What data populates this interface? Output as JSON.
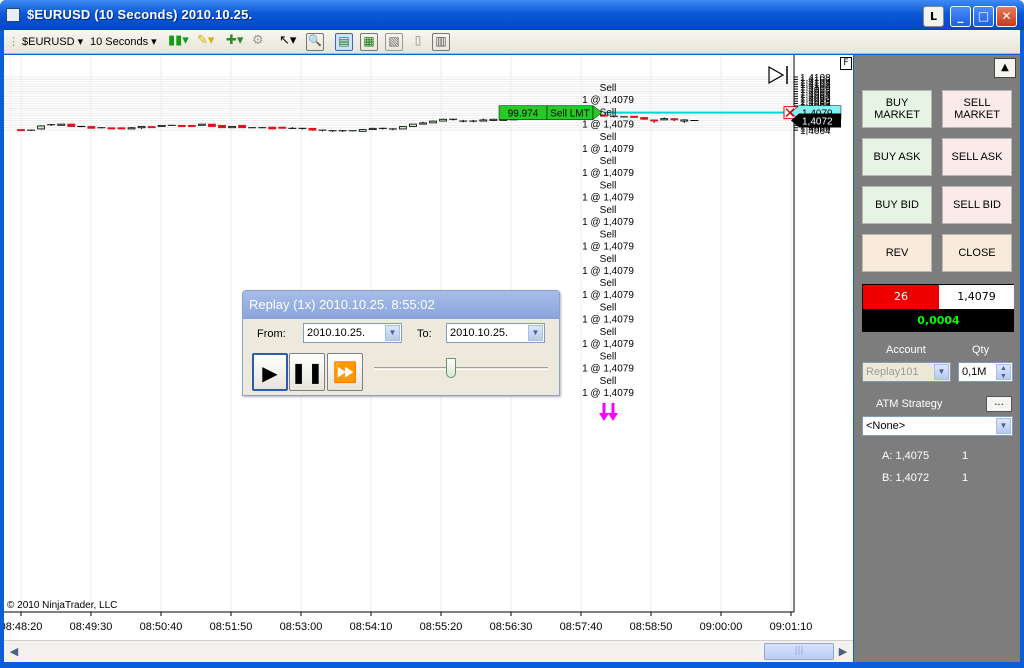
{
  "window": {
    "title": "$EURUSD (10 Seconds)  2010.10.25.",
    "buttons": {
      "lock": "L",
      "minimize": "_",
      "maximize": "□",
      "close": "✕"
    }
  },
  "toolbar": {
    "instrument": "$EURUSD",
    "interval": "10 Seconds",
    "icons": [
      "bar-style-icon",
      "pencil-draw-icon",
      "add-indicator-icon",
      "strategy-icon",
      "pointer-icon",
      "zoom-icon",
      "chart-trader-icon",
      "data-box-icon",
      "properties-icon",
      "page-icon",
      "columns-icon"
    ]
  },
  "chart": {
    "copyright": "© 2010 NinjaTrader, LLC",
    "f_marker": "F",
    "price_labels": [
      "1,4108",
      "1,4106",
      "1,4104",
      "1,4102",
      "1,4100",
      "1,4098",
      "1,4096",
      "1,4094",
      "1,4092",
      "1,4090",
      "1,4088",
      "1,4086",
      "1,4084",
      "1,4082",
      "1,4080",
      "1,4079",
      "1,4076",
      "1,4074",
      "1,4072",
      "1,4070",
      "1,4068",
      "1,4066",
      "1,4064"
    ],
    "time_labels": [
      "08:48:20",
      "08:49:30",
      "08:50:40",
      "08:51:50",
      "08:53:00",
      "08:54:10",
      "08:55:20",
      "08:56:30",
      "08:57:40",
      "08:58:50",
      "09:00:00",
      "09:01:10"
    ],
    "current_price_label": "1,4072",
    "order_line": {
      "qty": "99.974",
      "type": "Sell LMT",
      "price": "1,4079"
    },
    "execution_labels_top": "Sell",
    "execution_labels_bottom": "1 @ 1,4079",
    "execution_count": 13,
    "candles": [
      {
        "o": 1.40645,
        "h": 1.40645,
        "l": 1.40635,
        "c": 1.40635
      },
      {
        "o": 1.4064,
        "h": 1.40645,
        "l": 1.40635,
        "c": 1.4064
      },
      {
        "o": 1.4065,
        "h": 1.4068,
        "l": 1.40645,
        "c": 1.40675
      },
      {
        "o": 1.4068,
        "h": 1.4069,
        "l": 1.40675,
        "c": 1.40685
      },
      {
        "o": 1.4068,
        "h": 1.4069,
        "l": 1.4068,
        "c": 1.4069
      },
      {
        "o": 1.4069,
        "h": 1.4069,
        "l": 1.4067,
        "c": 1.4067
      },
      {
        "o": 1.4067,
        "h": 1.40675,
        "l": 1.40665,
        "c": 1.4067
      },
      {
        "o": 1.4067,
        "h": 1.40675,
        "l": 1.40655,
        "c": 1.40655
      },
      {
        "o": 1.40655,
        "h": 1.40665,
        "l": 1.40655,
        "c": 1.4066
      },
      {
        "o": 1.4066,
        "h": 1.4066,
        "l": 1.4065,
        "c": 1.4065
      },
      {
        "o": 1.4066,
        "h": 1.4066,
        "l": 1.4065,
        "c": 1.4065
      },
      {
        "o": 1.4065,
        "h": 1.40665,
        "l": 1.4065,
        "c": 1.4066
      },
      {
        "o": 1.4066,
        "h": 1.4067,
        "l": 1.4065,
        "c": 1.4067
      },
      {
        "o": 1.4067,
        "h": 1.4067,
        "l": 1.4066,
        "c": 1.4066
      },
      {
        "o": 1.4067,
        "h": 1.4068,
        "l": 1.4067,
        "c": 1.4068
      },
      {
        "o": 1.4068,
        "h": 1.4068,
        "l": 1.4068,
        "c": 1.4068
      },
      {
        "o": 1.4068,
        "h": 1.4068,
        "l": 1.4067,
        "c": 1.4067
      },
      {
        "o": 1.4068,
        "h": 1.4068,
        "l": 1.4067,
        "c": 1.4067
      },
      {
        "o": 1.4068,
        "h": 1.4069,
        "l": 1.4068,
        "c": 1.4069
      },
      {
        "o": 1.4069,
        "h": 1.4069,
        "l": 1.4067,
        "c": 1.4067
      },
      {
        "o": 1.4068,
        "h": 1.4068,
        "l": 1.4066,
        "c": 1.4066
      },
      {
        "o": 1.4066,
        "h": 1.4067,
        "l": 1.4066,
        "c": 1.4067
      },
      {
        "o": 1.4068,
        "h": 1.4068,
        "l": 1.4066,
        "c": 1.4066
      },
      {
        "o": 1.4066,
        "h": 1.40665,
        "l": 1.4066,
        "c": 1.4066
      },
      {
        "o": 1.4066,
        "h": 1.40665,
        "l": 1.4066,
        "c": 1.4066
      },
      {
        "o": 1.40665,
        "h": 1.40665,
        "l": 1.4065,
        "c": 1.4065
      },
      {
        "o": 1.40665,
        "h": 1.40665,
        "l": 1.40655,
        "c": 1.40655
      },
      {
        "o": 1.40655,
        "h": 1.40665,
        "l": 1.4065,
        "c": 1.40655
      },
      {
        "o": 1.40655,
        "h": 1.40655,
        "l": 1.40645,
        "c": 1.4065
      },
      {
        "o": 1.40655,
        "h": 1.40655,
        "l": 1.40635,
        "c": 1.4064
      },
      {
        "o": 1.4064,
        "h": 1.4064,
        "l": 1.4063,
        "c": 1.40635
      },
      {
        "o": 1.40635,
        "h": 1.40635,
        "l": 1.40625,
        "c": 1.4063
      },
      {
        "o": 1.4063,
        "h": 1.4064,
        "l": 1.40625,
        "c": 1.40635
      },
      {
        "o": 1.40635,
        "h": 1.40635,
        "l": 1.4063,
        "c": 1.4063
      },
      {
        "o": 1.4063,
        "h": 1.4065,
        "l": 1.4063,
        "c": 1.40645
      },
      {
        "o": 1.40645,
        "h": 1.4066,
        "l": 1.40645,
        "c": 1.40655
      },
      {
        "o": 1.40655,
        "h": 1.4066,
        "l": 1.40645,
        "c": 1.40655
      },
      {
        "o": 1.40645,
        "h": 1.40655,
        "l": 1.4064,
        "c": 1.4065
      },
      {
        "o": 1.4065,
        "h": 1.4067,
        "l": 1.4065,
        "c": 1.4067
      },
      {
        "o": 1.4067,
        "h": 1.4069,
        "l": 1.4067,
        "c": 1.4069
      },
      {
        "o": 1.4069,
        "h": 1.4071,
        "l": 1.4069,
        "c": 1.407
      },
      {
        "o": 1.407,
        "h": 1.4072,
        "l": 1.407,
        "c": 1.40715
      },
      {
        "o": 1.40715,
        "h": 1.40735,
        "l": 1.40715,
        "c": 1.4073
      },
      {
        "o": 1.4073,
        "h": 1.40735,
        "l": 1.4072,
        "c": 1.4073
      },
      {
        "o": 1.40715,
        "h": 1.40725,
        "l": 1.40705,
        "c": 1.40715
      },
      {
        "o": 1.40715,
        "h": 1.40725,
        "l": 1.40705,
        "c": 1.40715
      },
      {
        "o": 1.40715,
        "h": 1.40735,
        "l": 1.40715,
        "c": 1.40725
      },
      {
        "o": 1.4072,
        "h": 1.40735,
        "l": 1.40715,
        "c": 1.4073
      },
      {
        "o": 1.4072,
        "h": 1.40735,
        "l": 1.4072,
        "c": 1.4073
      },
      {
        "o": 1.40725,
        "h": 1.40745,
        "l": 1.40725,
        "c": 1.4074
      },
      {
        "o": 1.4074,
        "h": 1.4077,
        "l": 1.4074,
        "c": 1.4076
      },
      {
        "o": 1.4076,
        "h": 1.40765,
        "l": 1.40755,
        "c": 1.4076
      },
      {
        "o": 1.4076,
        "h": 1.40765,
        "l": 1.40755,
        "c": 1.4076
      },
      {
        "o": 1.40755,
        "h": 1.4077,
        "l": 1.4075,
        "c": 1.40765
      },
      {
        "o": 1.40765,
        "h": 1.40775,
        "l": 1.40765,
        "c": 1.4077
      },
      {
        "o": 1.4077,
        "h": 1.40785,
        "l": 1.4077,
        "c": 1.4078
      },
      {
        "o": 1.4078,
        "h": 1.4079,
        "l": 1.40775,
        "c": 1.40785
      },
      {
        "o": 1.40785,
        "h": 1.4079,
        "l": 1.4076,
        "c": 1.40765
      },
      {
        "o": 1.40765,
        "h": 1.40765,
        "l": 1.40755,
        "c": 1.40755
      },
      {
        "o": 1.40755,
        "h": 1.4076,
        "l": 1.40745,
        "c": 1.4075
      },
      {
        "o": 1.4075,
        "h": 1.40755,
        "l": 1.40745,
        "c": 1.4075
      },
      {
        "o": 1.40755,
        "h": 1.40755,
        "l": 1.4074,
        "c": 1.40745
      },
      {
        "o": 1.40745,
        "h": 1.40745,
        "l": 1.40725,
        "c": 1.4073
      },
      {
        "o": 1.40725,
        "h": 1.40725,
        "l": 1.407,
        "c": 1.40715
      },
      {
        "o": 1.40725,
        "h": 1.40745,
        "l": 1.40725,
        "c": 1.40735
      },
      {
        "o": 1.40735,
        "h": 1.4074,
        "l": 1.40715,
        "c": 1.40725
      },
      {
        "o": 1.40715,
        "h": 1.4073,
        "l": 1.407,
        "c": 1.40725
      },
      {
        "o": 1.4072,
        "h": 1.4072,
        "l": 1.4072,
        "c": 1.4072
      }
    ]
  },
  "replay": {
    "title": "Replay (1x) 2010.10.25.  8:55:02",
    "from_label": "From:",
    "from_value": "2010.10.25.",
    "to_label": "To:",
    "to_value": "2010.10.25.",
    "speed_position": 0.45
  },
  "trade_panel": {
    "buttons": {
      "buy_market": "BUY\nMARKET",
      "sell_market": "SELL\nMARKET",
      "buy_ask": "BUY ASK",
      "sell_ask": "SELL ASK",
      "buy_bid": "BUY BID",
      "sell_bid": "SELL BID",
      "rev": "REV",
      "close": "CLOSE"
    },
    "position": {
      "qty": "26",
      "price": "1,4079",
      "pnl": "0,0004"
    },
    "account_label": "Account",
    "account_value": "Replay101",
    "qty_label": "Qty",
    "qty_value": "0,1M",
    "atm_label": "ATM Strategy",
    "atm_button": "...",
    "atm_value": "<None>",
    "ask_label": "A: 1,4075",
    "ask_size": "1",
    "bid_label": "B: 1,4072",
    "bid_size": "1"
  }
}
